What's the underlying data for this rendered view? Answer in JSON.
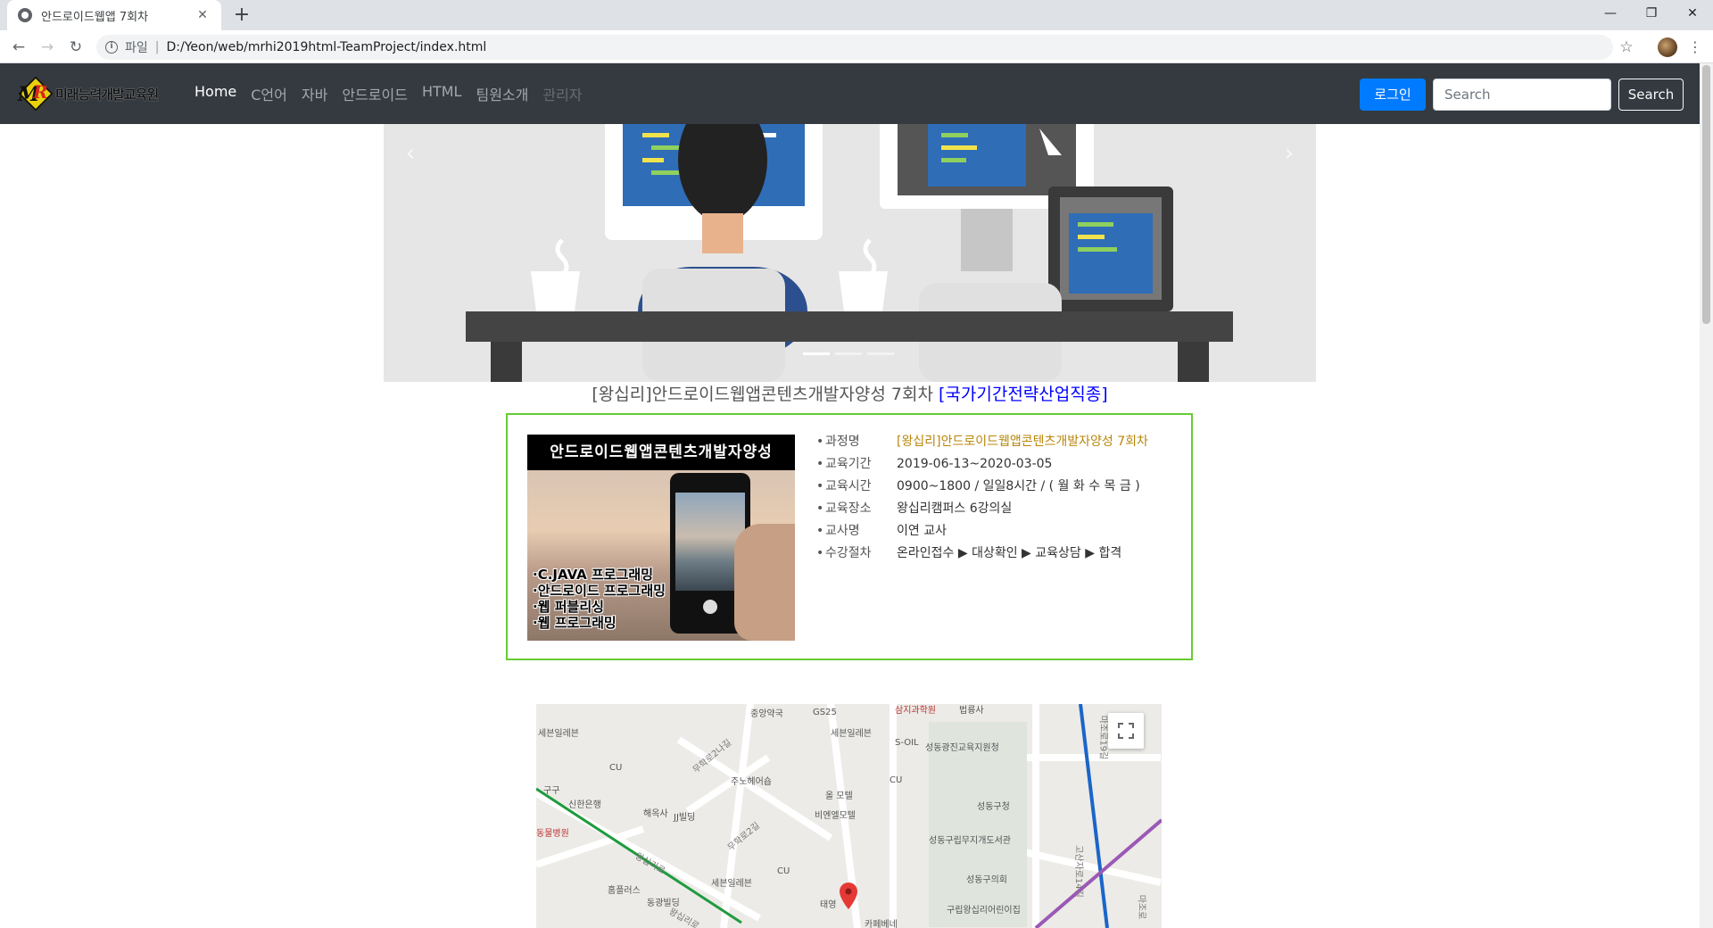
{
  "browser": {
    "tab_title": "안드로이드웹앱 7회차",
    "url_protocol": "파일",
    "url": "D:/Yeon/web/mrhi2019html-TeamProject/index.html",
    "new_tab": "+",
    "min": "—",
    "restore": "❐",
    "close": "✕"
  },
  "navbar": {
    "brand": "미래능력개발교육원",
    "links": [
      "Home",
      "C언어",
      "자바",
      "안드로이드",
      "HTML",
      "팀원소개",
      "관리자"
    ],
    "login": "로그인",
    "search_placeholder": "Search",
    "search_button": "Search"
  },
  "carousel": {
    "slide_count": 3,
    "active_index": 0
  },
  "course": {
    "title_main": "[왕십리]안드로이드웹앱콘텐츠개발자양성 7회차 ",
    "title_highlight": "[국가기간전략산업직종]",
    "poster_heading": "안드로이드웹앱콘텐츠개발자양성",
    "poster_items": [
      "·C.JAVA 프로그래밍",
      "·안드로이드 프로그래밍",
      "·웹 퍼블리싱",
      "·웹 프로그래밍"
    ],
    "details": [
      {
        "label": "과정명",
        "value": "[왕십리]안드로이드웹앱콘텐츠개발자양성 7회차"
      },
      {
        "label": "교육기간",
        "value": "2019-06-13~2020-03-05"
      },
      {
        "label": "교육시간",
        "value": "0900~1800 / 일일8시간 / ( 월 화 수 목 금 )"
      },
      {
        "label": "교육장소",
        "value": "왕십리캠퍼스 6강의실"
      },
      {
        "label": "교사명",
        "value": "이연 교사"
      },
      {
        "label": "수강절차",
        "value": "온라인접수 ▶ 대상확인 ▶ 교육상담 ▶ 합격"
      }
    ]
  },
  "map": {
    "labels": [
      "세븐일레븐",
      "CU",
      "구구",
      "신한은행",
      "해옥사",
      "JJ빌딩",
      "동물병원",
      "홈플러스",
      "동광빌딩",
      "주노헤어숍",
      "GS25",
      "중앙약국",
      "세븐일레븐",
      "S-OIL",
      "성동광진교육지원청",
      "법륭사",
      "삼지과학원",
      "올 모텔",
      "비엔엘모텔",
      "CU",
      "성동구청",
      "성동구립무지개도서관",
      "성동구의회",
      "구립왕십리어린이집",
      "세븐일레븐",
      "CU",
      "태영",
      "카페베네",
      "왕십리로",
      "무학로2길",
      "무학로2나길",
      "고산자로14길",
      "마조로",
      "마조로19길",
      "왕십리로"
    ]
  }
}
